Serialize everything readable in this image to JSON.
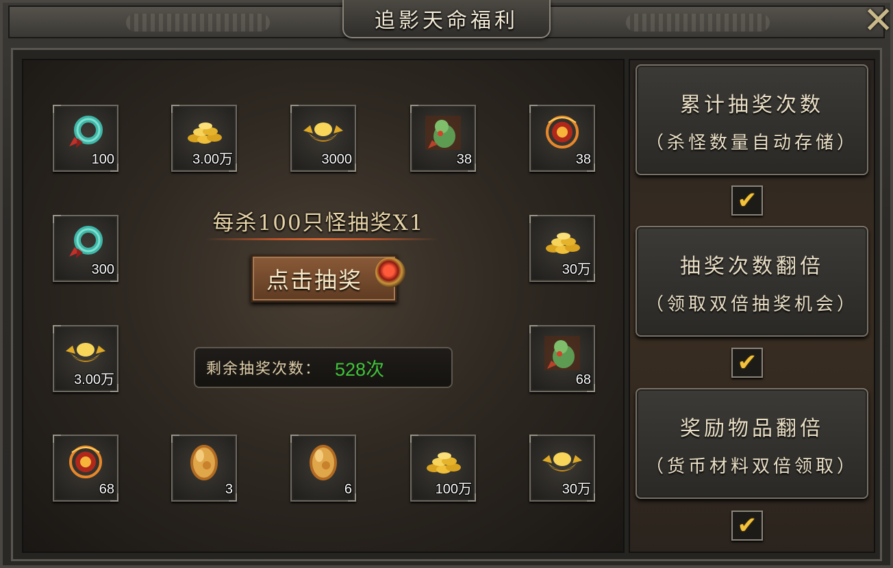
{
  "title": "追影天命福利",
  "close_icon": "close-x-icon",
  "grid": [
    {
      "icon": "jade-ring-icon",
      "count": "100"
    },
    {
      "icon": "gold-coins-icon",
      "count": "3.00万"
    },
    {
      "icon": "gold-ingot-icon",
      "count": "3000"
    },
    {
      "icon": "jade-gourd-icon",
      "count": "38"
    },
    {
      "icon": "fire-orb-icon",
      "count": "38"
    },
    {
      "icon": "jade-ring-icon",
      "count": "300"
    },
    {
      "icon": "gold-coins-icon",
      "count": "30万"
    },
    {
      "icon": "gold-ingot-icon",
      "count": "3.00万"
    },
    {
      "icon": "jade-gourd-icon",
      "count": "68"
    },
    {
      "icon": "fire-orb-icon",
      "count": "68"
    },
    {
      "icon": "amber-stone-icon",
      "count": "3"
    },
    {
      "icon": "amber-stone-icon",
      "count": "6"
    },
    {
      "icon": "gold-coins-icon",
      "count": "100万"
    },
    {
      "icon": "gold-ingot-icon",
      "count": "30万"
    }
  ],
  "lottery": {
    "rule_text": "每杀100只怪抽奖X1",
    "draw_button_label": "点击抽奖",
    "remaining_label": "剩余抽奖次数：",
    "remaining_value": "528次"
  },
  "options": [
    {
      "title": "累计抽奖次数",
      "subtitle": "（杀怪数量自动存储）",
      "checked": true
    },
    {
      "title": "抽奖次数翻倍",
      "subtitle": "（领取双倍抽奖机会）",
      "checked": true
    },
    {
      "title": "奖励物品翻倍",
      "subtitle": "（货币材料双倍领取）",
      "checked": true
    }
  ],
  "check_glyph": "✔",
  "colors": {
    "remaining_value": "#3fc43b",
    "check": "#f3c23a",
    "title_text": "#f3ead6"
  }
}
